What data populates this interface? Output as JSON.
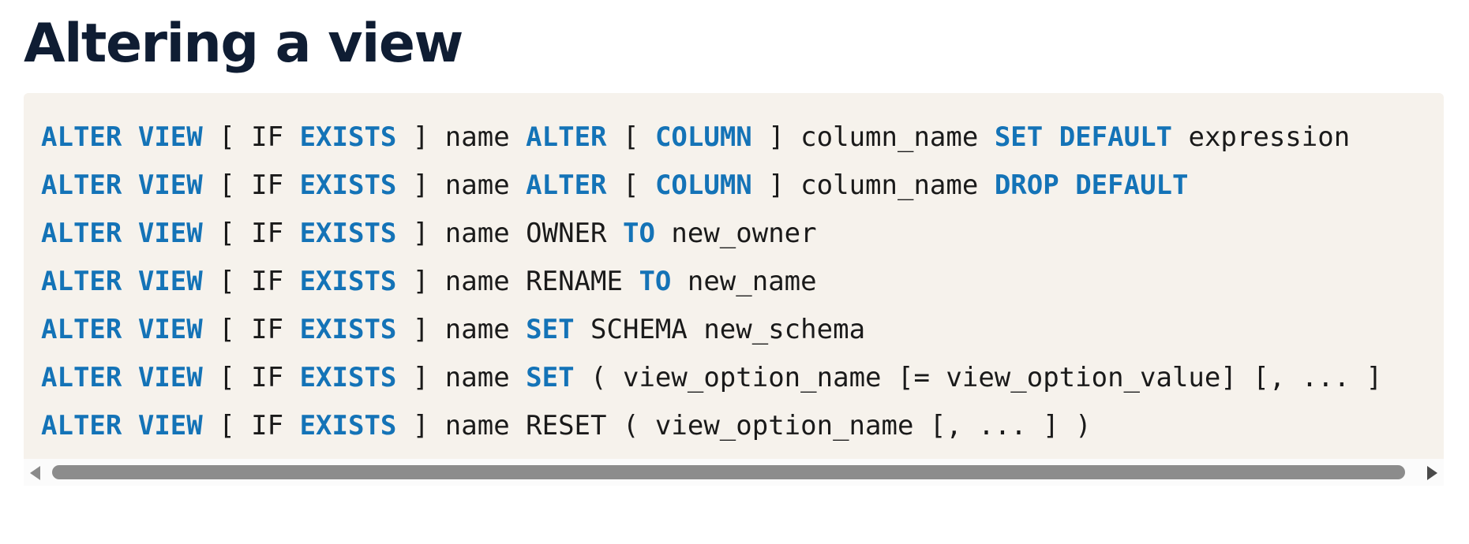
{
  "page": {
    "title": "Altering a view"
  },
  "colors": {
    "title": "#0f1d33",
    "keyword": "#1473b7",
    "text": "#1a1a1a",
    "code_background": "#f6f2ec",
    "scrollbar_thumb": "#8c8c8c"
  },
  "code": {
    "lines": [
      [
        {
          "t": "ALTER",
          "kw": true
        },
        {
          "t": " "
        },
        {
          "t": "VIEW",
          "kw": true
        },
        {
          "t": " [ IF "
        },
        {
          "t": "EXISTS",
          "kw": true
        },
        {
          "t": " ] name "
        },
        {
          "t": "ALTER",
          "kw": true
        },
        {
          "t": " [ "
        },
        {
          "t": "COLUMN",
          "kw": true
        },
        {
          "t": " ] column_name "
        },
        {
          "t": "SET",
          "kw": true
        },
        {
          "t": " "
        },
        {
          "t": "DEFAULT",
          "kw": true
        },
        {
          "t": " expression"
        }
      ],
      [
        {
          "t": "ALTER",
          "kw": true
        },
        {
          "t": " "
        },
        {
          "t": "VIEW",
          "kw": true
        },
        {
          "t": " [ IF "
        },
        {
          "t": "EXISTS",
          "kw": true
        },
        {
          "t": " ] name "
        },
        {
          "t": "ALTER",
          "kw": true
        },
        {
          "t": " [ "
        },
        {
          "t": "COLUMN",
          "kw": true
        },
        {
          "t": " ] column_name "
        },
        {
          "t": "DROP",
          "kw": true
        },
        {
          "t": " "
        },
        {
          "t": "DEFAULT",
          "kw": true
        }
      ],
      [
        {
          "t": "ALTER",
          "kw": true
        },
        {
          "t": " "
        },
        {
          "t": "VIEW",
          "kw": true
        },
        {
          "t": " [ IF "
        },
        {
          "t": "EXISTS",
          "kw": true
        },
        {
          "t": " ] name OWNER "
        },
        {
          "t": "TO",
          "kw": true
        },
        {
          "t": " new_owner"
        }
      ],
      [
        {
          "t": "ALTER",
          "kw": true
        },
        {
          "t": " "
        },
        {
          "t": "VIEW",
          "kw": true
        },
        {
          "t": " [ IF "
        },
        {
          "t": "EXISTS",
          "kw": true
        },
        {
          "t": " ] name RENAME "
        },
        {
          "t": "TO",
          "kw": true
        },
        {
          "t": " new_name"
        }
      ],
      [
        {
          "t": "ALTER",
          "kw": true
        },
        {
          "t": " "
        },
        {
          "t": "VIEW",
          "kw": true
        },
        {
          "t": " [ IF "
        },
        {
          "t": "EXISTS",
          "kw": true
        },
        {
          "t": " ] name "
        },
        {
          "t": "SET",
          "kw": true
        },
        {
          "t": " SCHEMA new_schema"
        }
      ],
      [
        {
          "t": "ALTER",
          "kw": true
        },
        {
          "t": " "
        },
        {
          "t": "VIEW",
          "kw": true
        },
        {
          "t": " [ IF "
        },
        {
          "t": "EXISTS",
          "kw": true
        },
        {
          "t": " ] name "
        },
        {
          "t": "SET",
          "kw": true
        },
        {
          "t": " ( view_option_name [= view_option_value] [, ... ]"
        }
      ],
      [
        {
          "t": "ALTER",
          "kw": true
        },
        {
          "t": " "
        },
        {
          "t": "VIEW",
          "kw": true
        },
        {
          "t": " [ IF "
        },
        {
          "t": "EXISTS",
          "kw": true
        },
        {
          "t": " ] name RESET ( view_option_name [, ... ] )"
        }
      ]
    ]
  },
  "scrollbar": {
    "left_icon": "scroll-left-icon",
    "right_icon": "scroll-right-icon"
  }
}
